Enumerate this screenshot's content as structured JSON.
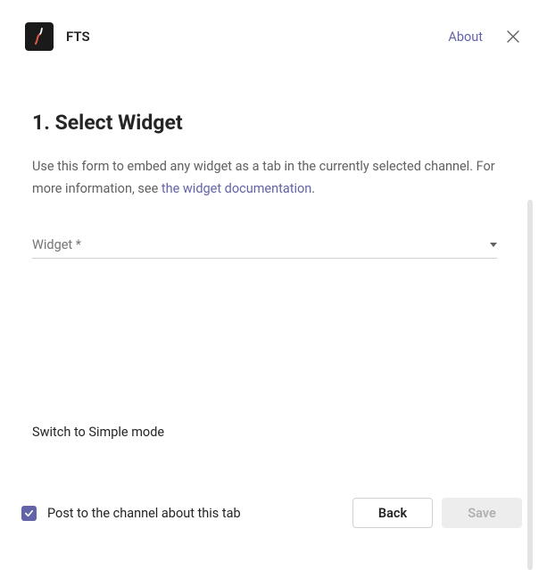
{
  "header": {
    "app_name": "FTS",
    "about_label": "About"
  },
  "main": {
    "heading": "1. Select Widget",
    "description_pre": "Use this form to embed any widget as a tab in the currently selected channel. For more information, see ",
    "doc_link_text": "the widget documentation",
    "description_post": ".",
    "widget_select": {
      "label": "Widget *",
      "value": ""
    },
    "switch_mode_label": "Switch to Simple mode"
  },
  "footer": {
    "checkbox_label": "Post to the channel about this tab",
    "checkbox_checked": true,
    "back_label": "Back",
    "save_label": "Save"
  }
}
